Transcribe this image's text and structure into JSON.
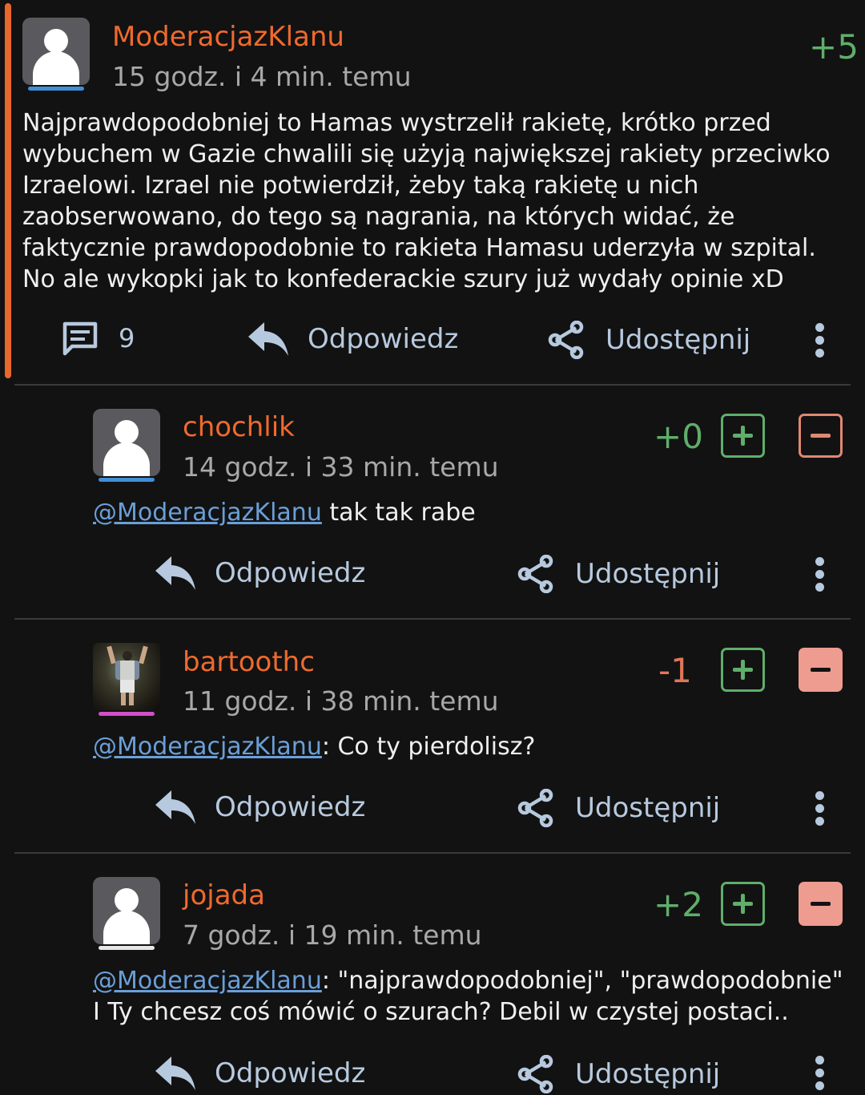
{
  "comments": [
    {
      "username": "ModeracjazKlanu",
      "time": "15 godz. i 4 min. temu",
      "score": "+5",
      "body": "Najprawdopodobniej to Hamas wystrzelił rakietę, krótko przed wybuchem w Gazie chwalili się użyją największej rakiety przeciwko Izraelowi. Izrael nie potwierdził, żeby taką rakietę u nich zaobserwowano, do tego są nagrania, na których widać, że faktycznie prawdopodobnie to rakieta Hamasu uderzyła w szpital. No ale wykopki jak to konfederackie szury już wydały opinie xD",
      "reply_count": "9",
      "reply_label": "Odpowiedz",
      "share_label": "Udostępnij",
      "underline_color": "#3f8fd6"
    },
    {
      "username": "chochlik",
      "time": "14 godz. i 33 min. temu",
      "score": "+0",
      "mention": "@ModeracjazKlanu",
      "body": " tak tak rabe",
      "reply_label": "Odpowiedz",
      "share_label": "Udostępnij",
      "underline_color": "#3f8fd6"
    },
    {
      "username": "bartoothc",
      "time": "11 godz. i 38 min. temu",
      "score": "-1",
      "mention": "@ModeracjazKlanu",
      "body": ": Co ty pierdolisz?",
      "reply_label": "Odpowiedz",
      "share_label": "Udostępnij",
      "underline_color": "#d24fc9"
    },
    {
      "username": "jojada",
      "time": "7 godz. i 19 min. temu",
      "score": "+2",
      "mention": "@ModeracjazKlanu",
      "body_line1": ": \"najprawdopodobniej\", \"prawdopodobnie\"",
      "body_line2": "I Ty chcesz coś mówić o szurach? Debil w czystej postaci..",
      "reply_label": "Odpowiedz",
      "share_label": "Udostępnij",
      "underline_color": "#e6e6e6"
    }
  ],
  "colors": {
    "background": "#121212",
    "username": "#ef6a2e",
    "positive": "#5fae6a",
    "negative": "#e0765a",
    "mention": "#6a9fd8",
    "action": "#b7c9de",
    "accent_bar": "#e8672c"
  },
  "icons": {
    "comments": "comment-lines-icon",
    "reply": "reply-arrow-icon",
    "share": "share-icon",
    "more": "kebab-menu-icon",
    "upvote": "plus-square-icon",
    "downvote": "minus-square-icon"
  }
}
